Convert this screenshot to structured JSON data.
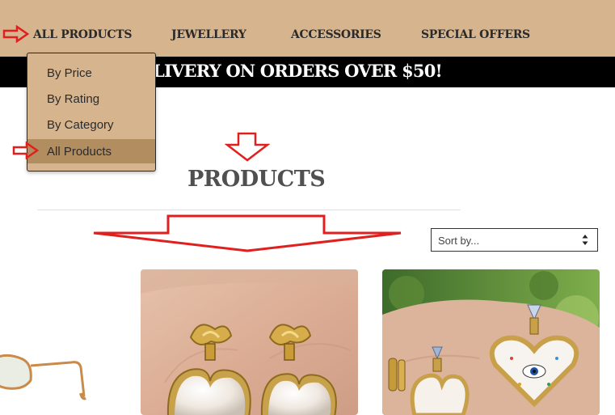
{
  "nav": {
    "items": [
      {
        "label": "ALL PRODUCTS"
      },
      {
        "label": "JEWELLERY"
      },
      {
        "label": "ACCESSORIES"
      },
      {
        "label": "SPECIAL OFFERS"
      }
    ]
  },
  "banner": {
    "text": "LIVERY ON ORDERS OVER $50!"
  },
  "dropdown": {
    "items": [
      {
        "label": "By Price"
      },
      {
        "label": "By Rating"
      },
      {
        "label": "By Category"
      },
      {
        "label": "All Products",
        "active": true
      }
    ]
  },
  "main": {
    "title": "PRODUCTS",
    "sort_placeholder": "Sort by..."
  },
  "products": [
    {
      "image": "gold-knot-pearl-heart-earrings-photo"
    },
    {
      "image": "gold-crystal-enamel-eye-heart-earrings-photo"
    }
  ],
  "partial_product": {
    "image": "gold-frame-sunglasses-photo"
  },
  "colors": {
    "nav_bg": "#d6b48e",
    "dropdown_active_bg": "#b28d60",
    "banner_bg": "#000000",
    "annotation_red": "#e0201e"
  }
}
